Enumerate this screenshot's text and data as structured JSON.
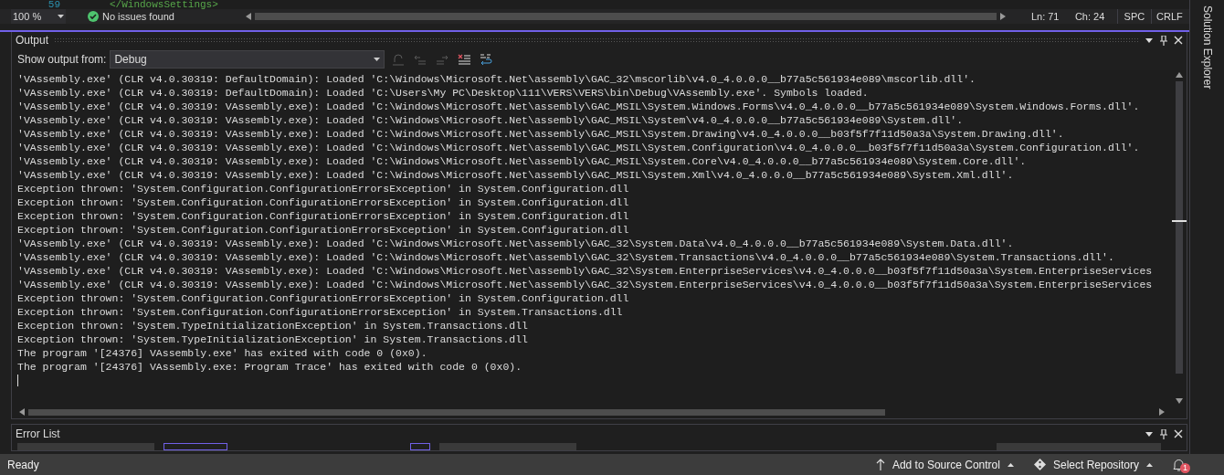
{
  "editor": {
    "line_number": "59",
    "code": "</WindowsSettings>"
  },
  "editor_status": {
    "zoom": "100 %",
    "issues": "No issues found",
    "line": "Ln: 71",
    "column": "Ch: 24",
    "whitespace": "SPC",
    "line_ending": "CRLF"
  },
  "output": {
    "title": "Output",
    "show_output_from_label": "Show output from:",
    "source": "Debug",
    "toolbar": [
      {
        "kind": "goto",
        "disabled": true
      },
      {
        "kind": "previous",
        "disabled": true
      },
      {
        "kind": "next",
        "disabled": true
      },
      {
        "kind": "clear",
        "disabled": false
      },
      {
        "kind": "wrap",
        "disabled": false
      }
    ],
    "lines": [
      "'VAssembly.exe' (CLR v4.0.30319: DefaultDomain): Loaded 'C:\\Windows\\Microsoft.Net\\assembly\\GAC_32\\mscorlib\\v4.0_4.0.0.0__b77a5c561934e089\\mscorlib.dll'.",
      "'VAssembly.exe' (CLR v4.0.30319: DefaultDomain): Loaded 'C:\\Users\\My PC\\Desktop\\111\\VERS\\VERS\\bin\\Debug\\VAssembly.exe'. Symbols loaded.",
      "'VAssembly.exe' (CLR v4.0.30319: VAssembly.exe): Loaded 'C:\\Windows\\Microsoft.Net\\assembly\\GAC_MSIL\\System.Windows.Forms\\v4.0_4.0.0.0__b77a5c561934e089\\System.Windows.Forms.dll'.",
      "'VAssembly.exe' (CLR v4.0.30319: VAssembly.exe): Loaded 'C:\\Windows\\Microsoft.Net\\assembly\\GAC_MSIL\\System\\v4.0_4.0.0.0__b77a5c561934e089\\System.dll'.",
      "'VAssembly.exe' (CLR v4.0.30319: VAssembly.exe): Loaded 'C:\\Windows\\Microsoft.Net\\assembly\\GAC_MSIL\\System.Drawing\\v4.0_4.0.0.0__b03f5f7f11d50a3a\\System.Drawing.dll'.",
      "'VAssembly.exe' (CLR v4.0.30319: VAssembly.exe): Loaded 'C:\\Windows\\Microsoft.Net\\assembly\\GAC_MSIL\\System.Configuration\\v4.0_4.0.0.0__b03f5f7f11d50a3a\\System.Configuration.dll'.",
      "'VAssembly.exe' (CLR v4.0.30319: VAssembly.exe): Loaded 'C:\\Windows\\Microsoft.Net\\assembly\\GAC_MSIL\\System.Core\\v4.0_4.0.0.0__b77a5c561934e089\\System.Core.dll'.",
      "'VAssembly.exe' (CLR v4.0.30319: VAssembly.exe): Loaded 'C:\\Windows\\Microsoft.Net\\assembly\\GAC_MSIL\\System.Xml\\v4.0_4.0.0.0__b77a5c561934e089\\System.Xml.dll'.",
      "Exception thrown: 'System.Configuration.ConfigurationErrorsException' in System.Configuration.dll",
      "Exception thrown: 'System.Configuration.ConfigurationErrorsException' in System.Configuration.dll",
      "Exception thrown: 'System.Configuration.ConfigurationErrorsException' in System.Configuration.dll",
      "Exception thrown: 'System.Configuration.ConfigurationErrorsException' in System.Configuration.dll",
      "'VAssembly.exe' (CLR v4.0.30319: VAssembly.exe): Loaded 'C:\\Windows\\Microsoft.Net\\assembly\\GAC_32\\System.Data\\v4.0_4.0.0.0__b77a5c561934e089\\System.Data.dll'.",
      "'VAssembly.exe' (CLR v4.0.30319: VAssembly.exe): Loaded 'C:\\Windows\\Microsoft.Net\\assembly\\GAC_32\\System.Transactions\\v4.0_4.0.0.0__b77a5c561934e089\\System.Transactions.dll'.",
      "'VAssembly.exe' (CLR v4.0.30319: VAssembly.exe): Loaded 'C:\\Windows\\Microsoft.Net\\assembly\\GAC_32\\System.EnterpriseServices\\v4.0_4.0.0.0__b03f5f7f11d50a3a\\System.EnterpriseServices",
      "'VAssembly.exe' (CLR v4.0.30319: VAssembly.exe): Loaded 'C:\\Windows\\Microsoft.Net\\assembly\\GAC_32\\System.EnterpriseServices\\v4.0_4.0.0.0__b03f5f7f11d50a3a\\System.EnterpriseServices",
      "Exception thrown: 'System.Configuration.ConfigurationErrorsException' in System.Configuration.dll",
      "Exception thrown: 'System.Configuration.ConfigurationErrorsException' in System.Transactions.dll",
      "Exception thrown: 'System.TypeInitializationException' in System.Transactions.dll",
      "Exception thrown: 'System.TypeInitializationException' in System.Transactions.dll",
      "The program '[24376] VAssembly.exe' has exited with code 0 (0x0).",
      "The program '[24376] VAssembly.exe: Program Trace' has exited with code 0 (0x0)."
    ]
  },
  "error_list": {
    "title": "Error List"
  },
  "side_tab": "Solution Explorer",
  "status_bar": {
    "state": "Ready",
    "source_control": "Add to Source Control",
    "repository": "Select Repository",
    "notifications": "1"
  }
}
